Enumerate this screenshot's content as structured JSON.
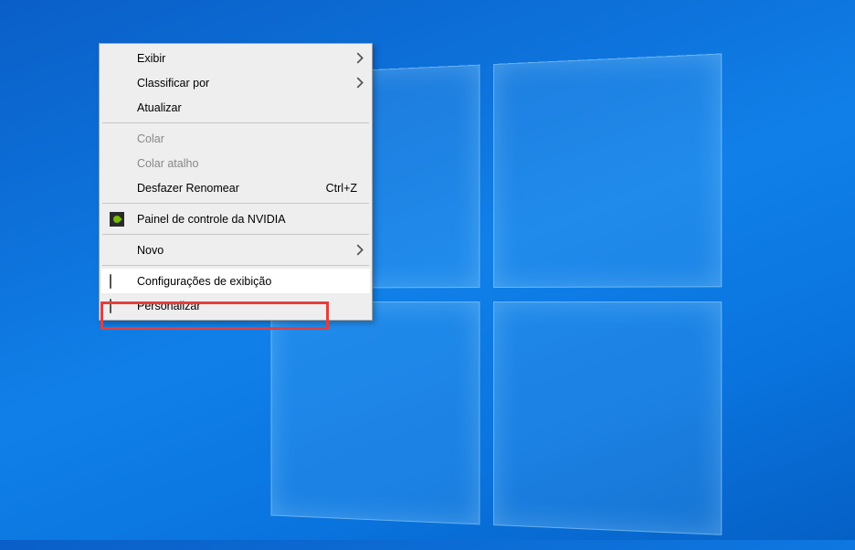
{
  "context_menu": {
    "items": [
      {
        "label": "Exibir",
        "has_submenu": true,
        "enabled": true,
        "icon": null
      },
      {
        "label": "Classificar por",
        "has_submenu": true,
        "enabled": true,
        "icon": null
      },
      {
        "label": "Atualizar",
        "has_submenu": false,
        "enabled": true,
        "icon": null
      },
      {
        "type": "separator"
      },
      {
        "label": "Colar",
        "has_submenu": false,
        "enabled": false,
        "icon": null
      },
      {
        "label": "Colar atalho",
        "has_submenu": false,
        "enabled": false,
        "icon": null
      },
      {
        "label": "Desfazer Renomear",
        "shortcut": "Ctrl+Z",
        "has_submenu": false,
        "enabled": true,
        "icon": null
      },
      {
        "type": "separator"
      },
      {
        "label": "Painel de controle da NVIDIA",
        "has_submenu": false,
        "enabled": true,
        "icon": "nvidia"
      },
      {
        "type": "separator"
      },
      {
        "label": "Novo",
        "has_submenu": true,
        "enabled": true,
        "icon": null
      },
      {
        "type": "separator"
      },
      {
        "label": "Configurações de exibição",
        "has_submenu": false,
        "enabled": true,
        "icon": "display-settings",
        "hovered": true,
        "highlighted": true
      },
      {
        "label": "Personalizar",
        "has_submenu": false,
        "enabled": true,
        "icon": "personalize"
      }
    ]
  },
  "colors": {
    "highlight_frame": "#e53e3e",
    "menu_bg": "#eeeeee",
    "menu_hover": "#ffffff",
    "disabled_text": "#888888"
  }
}
